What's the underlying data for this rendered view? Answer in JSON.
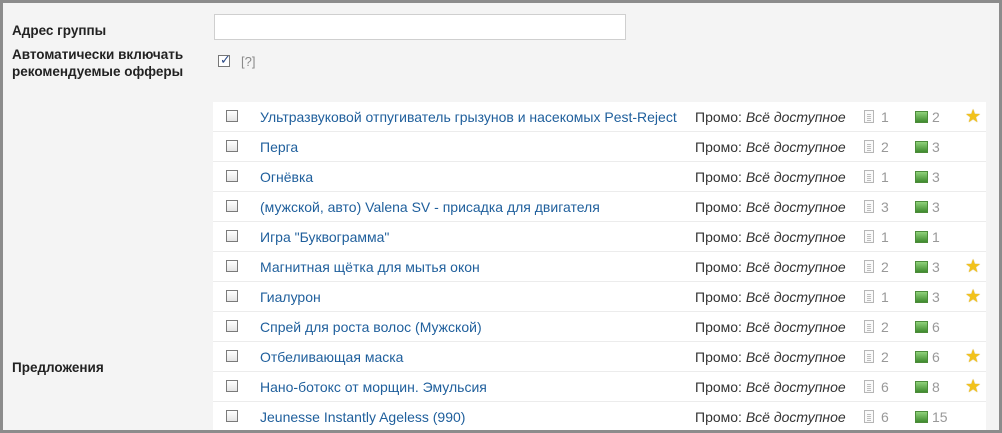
{
  "form": {
    "address_label": "Адрес группы",
    "address_value": "",
    "auto_label_line1": "Автоматически включать",
    "auto_label_line2": "рекомендуемые офферы",
    "auto_checked": true,
    "help_text": "[?]",
    "offers_label": "Предложения"
  },
  "offers": [
    {
      "name": "Ультразвуковой отпугиватель грызунов и насекомых Pest-Reject",
      "promo_label": "Промо:",
      "promo_value": "Всё доступное",
      "docs": "1",
      "images": "2",
      "starred": true
    },
    {
      "name": "Перга",
      "promo_label": "Промо:",
      "promo_value": "Всё доступное",
      "docs": "2",
      "images": "3",
      "starred": false
    },
    {
      "name": "Огнёвка",
      "promo_label": "Промо:",
      "promo_value": "Всё доступное",
      "docs": "1",
      "images": "3",
      "starred": false
    },
    {
      "name": "(мужской, авто) Valena SV - присадка для двигателя",
      "promo_label": "Промо:",
      "promo_value": "Всё доступное",
      "docs": "3",
      "images": "3",
      "starred": false
    },
    {
      "name": "Игра \"Буквограмма\"",
      "promo_label": "Промо:",
      "promo_value": "Всё доступное",
      "docs": "1",
      "images": "1",
      "starred": false
    },
    {
      "name": "Магнитная щётка для мытья окон",
      "promo_label": "Промо:",
      "promo_value": "Всё доступное",
      "docs": "2",
      "images": "3",
      "starred": true
    },
    {
      "name": "Гиалурон",
      "promo_label": "Промо:",
      "promo_value": "Всё доступное",
      "docs": "1",
      "images": "3",
      "starred": true
    },
    {
      "name": "Спрей для роста волос (Мужской)",
      "promo_label": "Промо:",
      "promo_value": "Всё доступное",
      "docs": "2",
      "images": "6",
      "starred": false
    },
    {
      "name": "Отбеливающая маска",
      "promo_label": "Промо:",
      "promo_value": "Всё доступное",
      "docs": "2",
      "images": "6",
      "starred": true
    },
    {
      "name": "Нано-ботокс от морщин. Эмульсия",
      "promo_label": "Промо:",
      "promo_value": "Всё доступное",
      "docs": "6",
      "images": "8",
      "starred": true
    },
    {
      "name": "Jeunesse Instantly Ageless (990)",
      "promo_label": "Промо:",
      "promo_value": "Всё доступное",
      "docs": "6",
      "images": "15",
      "starred": false
    }
  ],
  "icons": {
    "doc": "document-icon",
    "image": "image-icon",
    "star": "star-icon"
  },
  "colors": {
    "link": "#1f5f9c",
    "star": "#f2c21b",
    "border": "#8c8c8c"
  }
}
